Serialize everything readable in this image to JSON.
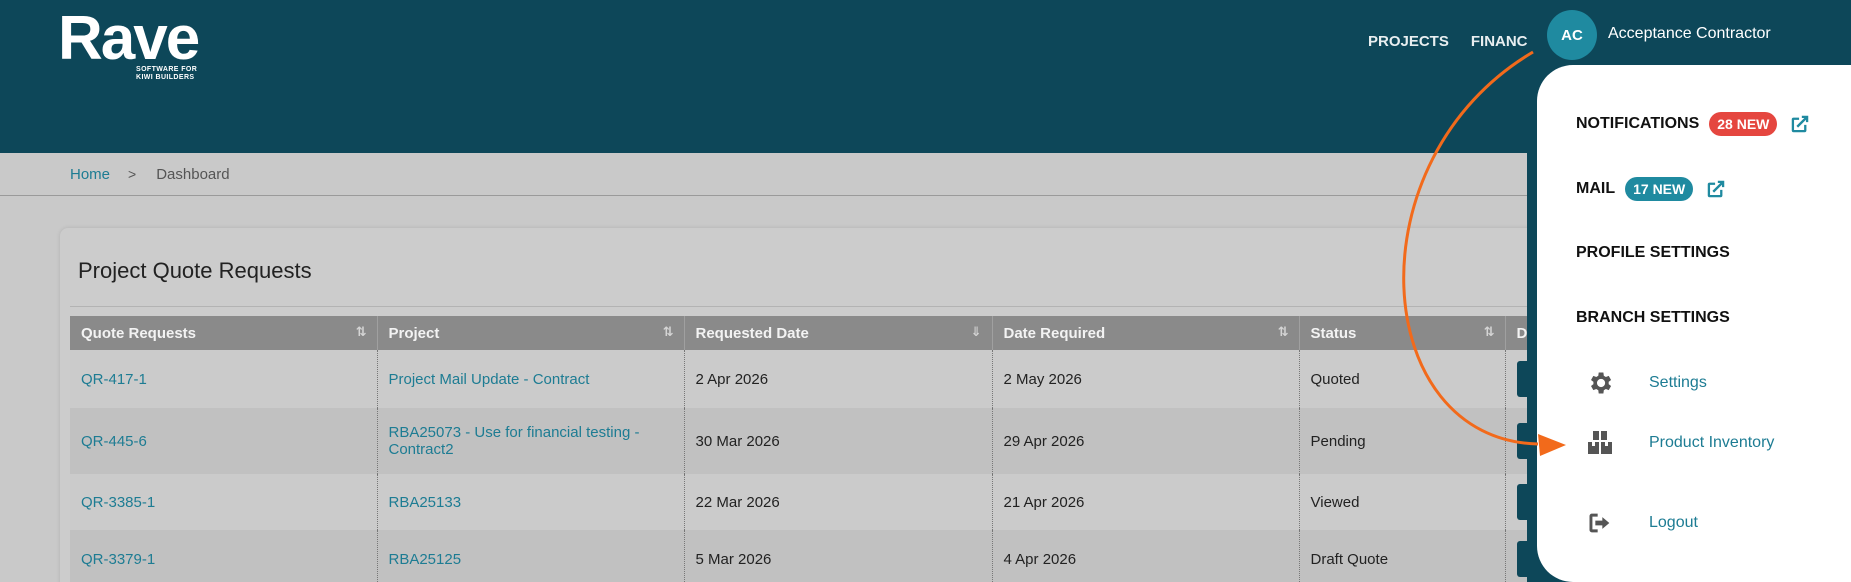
{
  "brand": {
    "name": "Rave",
    "tagline_1": "SOFTWARE FOR",
    "tagline_2": "KIWI BUILDERS"
  },
  "nav": {
    "items": [
      "PROJECTS",
      "FINANCI"
    ]
  },
  "breadcrumb": {
    "home": "Home",
    "separator": ">",
    "current": "Dashboard"
  },
  "card": {
    "title": "Project Quote Requests",
    "columns": [
      "Quote Requests",
      "Project",
      "Requested Date",
      "Date Required",
      "Status",
      "D"
    ],
    "rows": [
      {
        "quote": "QR-417-1",
        "project": "Project Mail Update - Contract",
        "project_line2": "",
        "requested": "2 Apr 2026",
        "required": "2 May 2026",
        "status": "Quoted"
      },
      {
        "quote": "QR-445-6",
        "project": "RBA25073 - Use for financial testing -",
        "project_line2": "Contract2",
        "requested": "30 Mar 2026",
        "required": "29 Apr 2026",
        "status": "Pending"
      },
      {
        "quote": "QR-3385-1",
        "project": "RBA25133",
        "project_line2": "",
        "requested": "22 Mar 2026",
        "required": "21 Apr 2026",
        "status": "Viewed"
      },
      {
        "quote": "QR-3379-1",
        "project": "RBA25125",
        "project_line2": "",
        "requested": "5 Mar 2026",
        "required": "4 Apr 2026",
        "status": "Draft Quote"
      }
    ]
  },
  "user": {
    "initials": "AC",
    "name": "Acceptance Contractor"
  },
  "menu": {
    "notifications": {
      "label": "NOTIFICATIONS",
      "badge": "28 NEW"
    },
    "mail": {
      "label": "MAIL",
      "badge": "17 NEW"
    },
    "profile": {
      "label": "PROFILE SETTINGS"
    },
    "branch": {
      "label": "BRANCH SETTINGS"
    },
    "settings": {
      "label": "Settings",
      "icon": "gear-icon"
    },
    "inventory": {
      "label": "Product Inventory",
      "icon": "boxes-icon"
    },
    "logout": {
      "label": "Logout",
      "icon": "logout-icon"
    }
  },
  "colors": {
    "header": "#0d4759",
    "accent": "#1d7c93",
    "badge_red": "#e5463f",
    "badge_teal": "#1f8aa0",
    "annotation": "#f26a1b"
  }
}
